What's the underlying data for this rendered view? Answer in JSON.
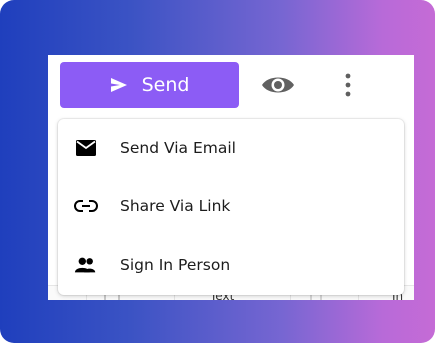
{
  "toolbar": {
    "send_label": "Send",
    "send_color": "#8c5cf5",
    "send_icon": "send-arrow-icon",
    "preview_icon": "eye-icon",
    "more_icon": "more-vertical-icon"
  },
  "menu": {
    "items": [
      {
        "label": "Send Via Email",
        "icon": "envelope-icon"
      },
      {
        "label": "Share Via Link",
        "icon": "link-icon"
      },
      {
        "label": "Sign In Person",
        "icon": "people-icon"
      }
    ]
  },
  "background": {
    "partial_column_label": "Text",
    "partial_column_label_2": "In"
  }
}
